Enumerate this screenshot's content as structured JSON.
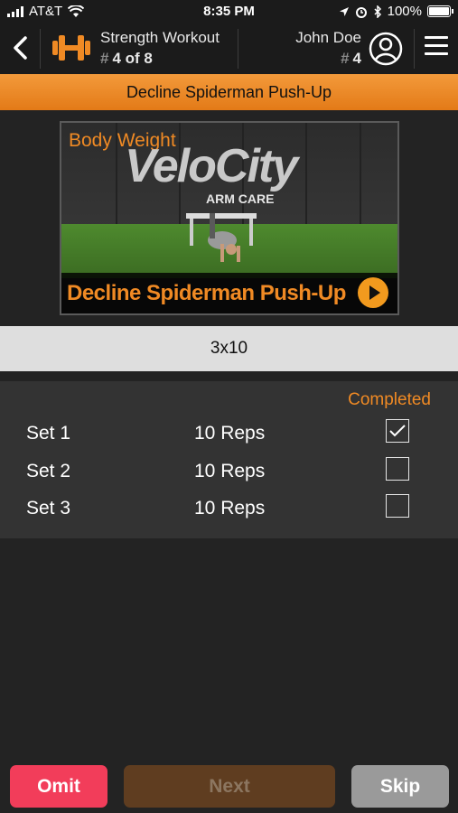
{
  "status_bar": {
    "carrier": "AT&T",
    "time": "8:35 PM",
    "battery": "100%"
  },
  "header": {
    "workout_title": "Strength Workout",
    "workout_position": "4 of 8",
    "hash_symbol": "#",
    "user_name": "John Doe",
    "user_number": "4"
  },
  "exercise": {
    "name": "Decline Spiderman Push-Up",
    "video_category": "Body Weight",
    "video_logo": "VeloCity",
    "video_sublogo": "ARM CARE",
    "video_title": "Decline Spiderman Push-Up",
    "scheme": "3x10"
  },
  "sets": {
    "completed_header": "Completed",
    "rows": [
      {
        "label": "Set 1",
        "reps": "10 Reps",
        "completed": true
      },
      {
        "label": "Set 2",
        "reps": "10 Reps",
        "completed": false
      },
      {
        "label": "Set 3",
        "reps": "10 Reps",
        "completed": false
      }
    ]
  },
  "actions": {
    "omit": "Omit",
    "next": "Next",
    "skip": "Skip"
  },
  "colors": {
    "accent": "#f08a24",
    "omit": "#f23d5a",
    "next_disabled": "#5f3d20",
    "skip": "#9a9a9a"
  },
  "icons": [
    "cellular-signal-icon",
    "wifi-icon",
    "location-icon",
    "alarm-icon",
    "bluetooth-icon",
    "battery-icon",
    "back-chevron-icon",
    "dumbbell-icon",
    "user-avatar-icon",
    "menu-icon",
    "play-icon",
    "checkmark-icon"
  ]
}
